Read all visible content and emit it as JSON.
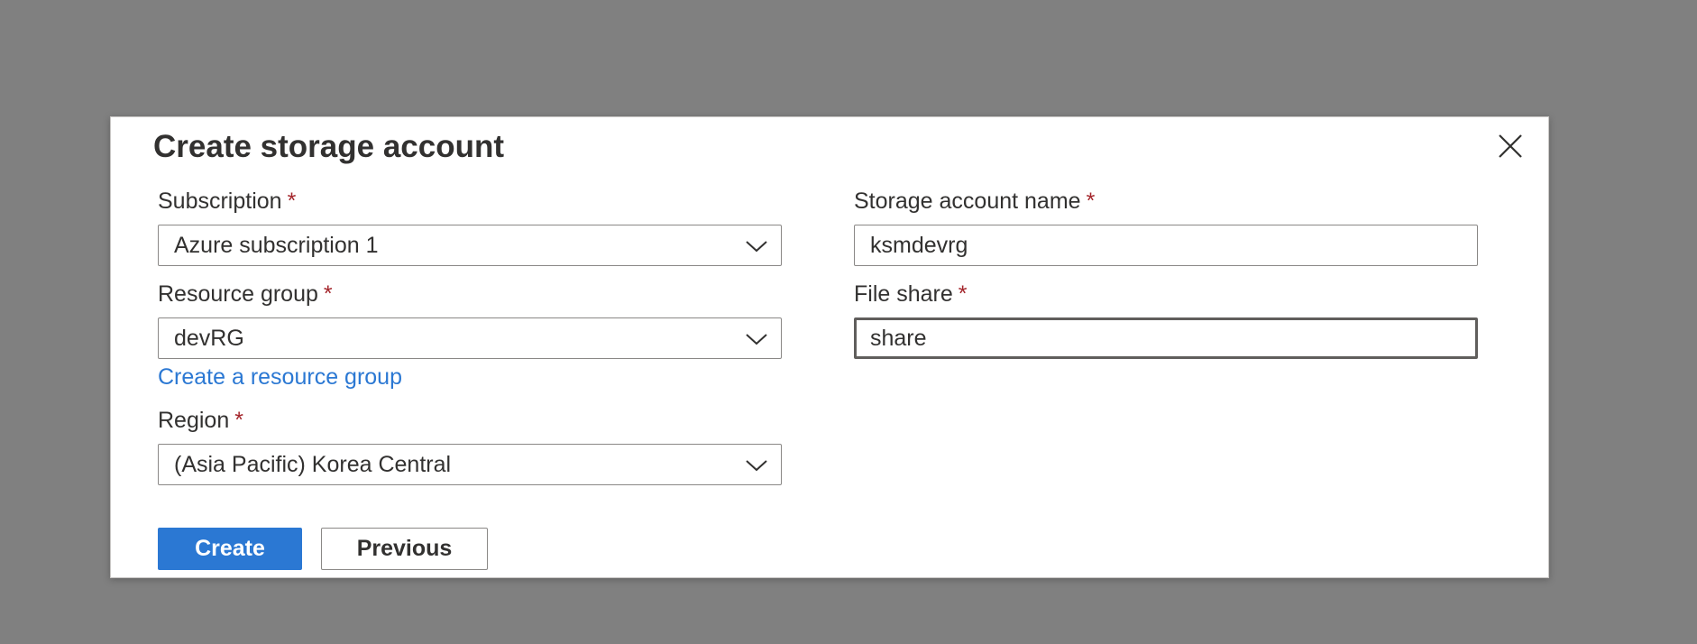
{
  "dialog": {
    "title": "Create storage account",
    "close_icon": "close-icon"
  },
  "fields": {
    "subscription": {
      "label": "Subscription",
      "required": "*",
      "value": "Azure subscription 1"
    },
    "resource_group": {
      "label": "Resource group",
      "required": "*",
      "value": "devRG",
      "link": "Create a resource group"
    },
    "region": {
      "label": "Region",
      "required": "*",
      "value": "(Asia Pacific) Korea Central"
    },
    "storage_account_name": {
      "label": "Storage account name",
      "required": "*",
      "value": "ksmdevrg"
    },
    "file_share": {
      "label": "File share",
      "required": "*",
      "value": "share"
    }
  },
  "buttons": {
    "create": "Create",
    "previous": "Previous"
  },
  "colors": {
    "overlay": "#808080",
    "primary": "#2b78d3",
    "required": "#a4262c",
    "text": "#323130"
  }
}
